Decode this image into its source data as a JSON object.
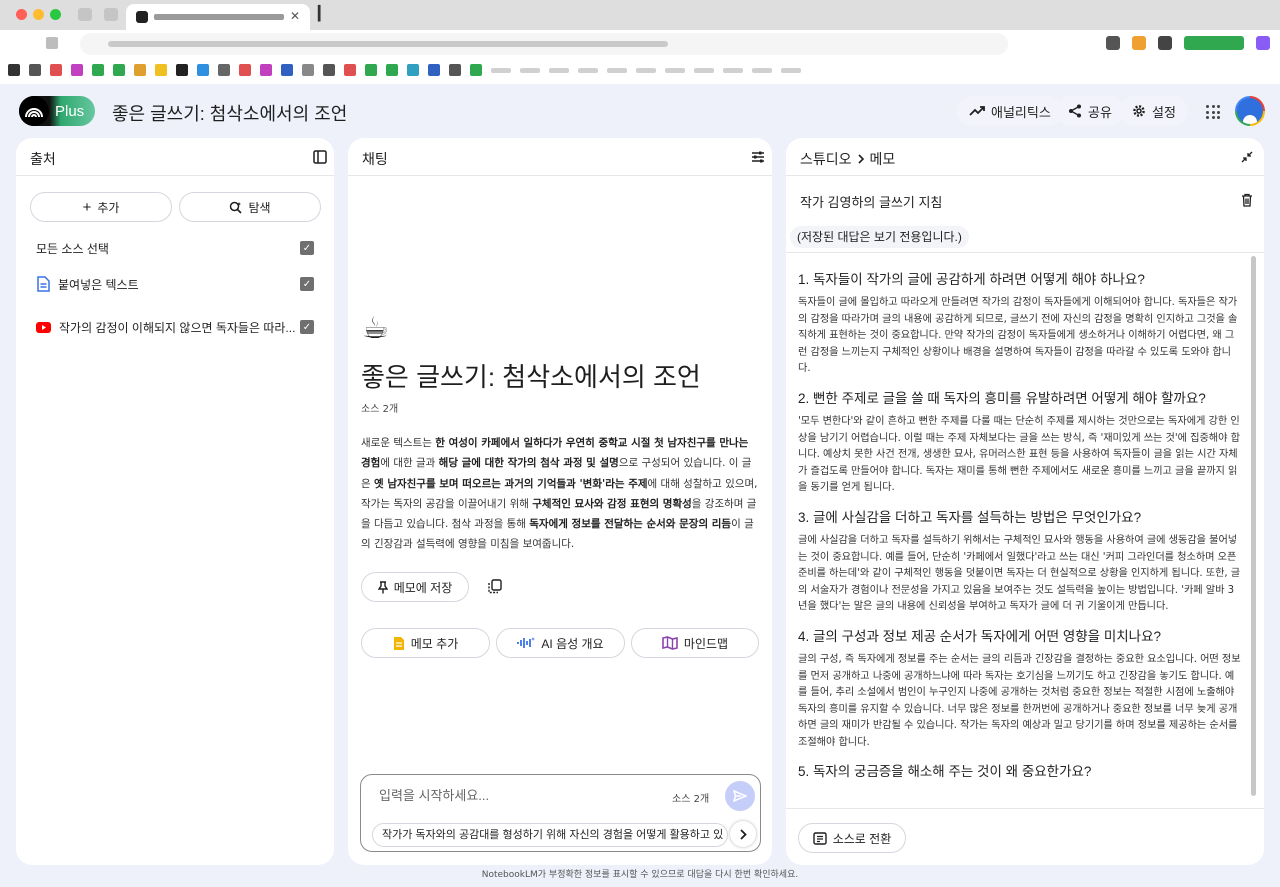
{
  "app": {
    "logo_label": "Plus",
    "notebook_title": "좋은 글쓰기: 첨삭소에서의 조언",
    "header_actions": {
      "analytics": "애널리틱스",
      "share": "공유",
      "settings": "설정"
    }
  },
  "sources": {
    "title": "출처",
    "add_label": "추가",
    "explore_label": "탐색",
    "select_all_label": "모든 소스 선택",
    "items": [
      {
        "icon": "document-icon",
        "label": "붙여넣은 텍스트"
      },
      {
        "icon": "youtube-icon",
        "label": "작가의 감정이 이해되지 않으면 독자들은 따라..."
      }
    ]
  },
  "chat": {
    "title": "채팅",
    "emoji": "☕",
    "notebook_title": "좋은 글쓰기: 첨삭소에서의 조언",
    "source_count": "소스 2개",
    "summary": [
      {
        "t": "새로운 텍스트는 ",
        "b": false
      },
      {
        "t": "한 여성이 카페에서 일하다가 우연히 중학교 시절 첫 남자친구를 만나는 경험",
        "b": true
      },
      {
        "t": "에 대한 글과 ",
        "b": false
      },
      {
        "t": "해당 글에 대한 작가의 첨삭 과정 및 설명",
        "b": true
      },
      {
        "t": "으로 구성되어 있습니다. 이 글은 ",
        "b": false
      },
      {
        "t": "옛 남자친구를 보며 떠오르는 과거의 기억들과 '변화'라는 주제",
        "b": true
      },
      {
        "t": "에 대해 성찰하고 있으며, 작가는 독자의 공감을 이끌어내기 위해 ",
        "b": false
      },
      {
        "t": "구체적인 묘사와 감정 표현의 명확성",
        "b": true
      },
      {
        "t": "을 강조하며 글을 다듬고 있습니다. 첨삭 과정을 통해 ",
        "b": false
      },
      {
        "t": "독자에게 정보를 전달하는 순서와 문장의 리듬",
        "b": true
      },
      {
        "t": "이 글의 긴장감과 설득력에 영향을 미침을 보여줍니다.",
        "b": false
      }
    ],
    "save_to_note_label": "메모에 저장",
    "actions": {
      "add_note": "메모 추가",
      "audio_overview": "AI 음성 개요",
      "mind_map": "마인드맵"
    },
    "composer": {
      "placeholder": "입력을 시작하세요...",
      "source_count": "소스 2개",
      "suggestion": "작가가 독자와의 공감대를 형성하기 위해 자신의 경험을 어떻게 활용하고 있"
    }
  },
  "studio": {
    "breadcrumb_root": "스튜디오",
    "breadcrumb_current": "메모",
    "note_title": "작가 김영하의 글쓰기 지침",
    "readonly_notice": "(저장된 대답은 보기 전용입니다.)",
    "qa": [
      {
        "q": "1. 독자들이 작가의 글에 공감하게 하려면 어떻게 해야 하나요?",
        "a": "독자들이 글에 몰입하고 따라오게 만들려면 작가의 감정이 독자들에게 이해되어야 합니다. 독자들은 작가의 감정을 따라가며 글의 내용에 공감하게 되므로, 글쓰기 전에 자신의 감정을 명확히 인지하고 그것을 솔직하게 표현하는 것이 중요합니다. 만약 작가의 감정이 독자들에게 생소하거나 이해하기 어렵다면, 왜 그런 감정을 느끼는지 구체적인 상황이나 배경을 설명하여 독자들이 감정을 따라갈 수 있도록 도와야 합니다."
      },
      {
        "q": "2. 뻔한 주제로 글을 쓸 때 독자의 흥미를 유발하려면 어떻게 해야 할까요?",
        "a": "'모두 변한다'와 같이 흔하고 뻔한 주제를 다룰 때는 단순히 주제를 제시하는 것만으로는 독자에게 강한 인상을 남기기 어렵습니다. 이럴 때는 주제 자체보다는 글을 쓰는 방식, 즉 '재미있게 쓰는 것'에 집중해야 합니다. 예상치 못한 사건 전개, 생생한 묘사, 유머러스한 표현 등을 사용하여 독자들이 글을 읽는 시간 자체가 즐겁도록 만들어야 합니다. 독자는 재미를 통해 뻔한 주제에서도 새로운 흥미를 느끼고 글을 끝까지 읽을 동기를 얻게 됩니다."
      },
      {
        "q": "3. 글에 사실감을 더하고 독자를 설득하는 방법은 무엇인가요?",
        "a": "글에 사실감을 더하고 독자를 설득하기 위해서는 구체적인 묘사와 행동을 사용하여 글에 생동감을 불어넣는 것이 중요합니다. 예를 들어, 단순히 '카페에서 일했다'라고 쓰는 대신 '커피 그라인더를 청소하며 오픈 준비를 하는데'와 같이 구체적인 행동을 덧붙이면 독자는 더 현실적으로 상황을 인지하게 됩니다. 또한, 글의 서술자가 경험이나 전문성을 가지고 있음을 보여주는 것도 설득력을 높이는 방법입니다. '카페 알바 3년을 했다'는 말은 글의 내용에 신뢰성을 부여하고 독자가 글에 더 귀 기울이게 만듭니다."
      },
      {
        "q": "4. 글의 구성과 정보 제공 순서가 독자에게 어떤 영향을 미치나요?",
        "a": "글의 구성, 즉 독자에게 정보를 주는 순서는 글의 리듬과 긴장감을 결정하는 중요한 요소입니다. 어떤 정보를 먼저 공개하고 나중에 공개하느냐에 따라 독자는 호기심을 느끼기도 하고 긴장감을 놓기도 합니다. 예를 들어, 추리 소설에서 범인이 누구인지 나중에 공개하는 것처럼 중요한 정보는 적절한 시점에 노출해야 독자의 흥미를 유지할 수 있습니다. 너무 많은 정보를 한꺼번에 공개하거나 중요한 정보를 너무 늦게 공개하면 글의 재미가 반감될 수 있습니다. 작가는 독자의 예상과 밀고 당기기를 하며 정보를 제공하는 순서를 조절해야 합니다."
      },
      {
        "q": "5. 독자의 궁금증을 해소해 주는 것이 왜 중요한가요?",
        "a": ""
      }
    ],
    "convert_label": "소스로 전환"
  },
  "footer": {
    "disclaimer": "NotebookLM가 부정확한 정보를 표시할 수 있으므로 대답을 다시 한번 확인하세요."
  }
}
